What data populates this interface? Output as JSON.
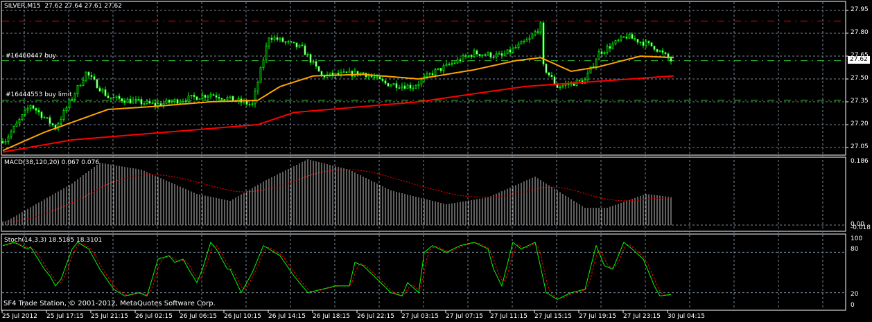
{
  "header": {
    "symbol": "SILVER,M15",
    "ohlc": "27.62 27.64 27.61 27.62"
  },
  "orders": [
    {
      "label": "#16460447 buy",
      "price": 27.62,
      "color": "#32cd32"
    },
    {
      "label": "#16444553 buy limit",
      "price": 27.36,
      "color": "#32cd32"
    }
  ],
  "resistance_line": {
    "price": 27.88,
    "color": "#ff0000"
  },
  "current_price": "27.62",
  "price_scale": [
    "27.95",
    "27.80",
    "27.65",
    "27.50",
    "27.35",
    "27.20",
    "27.05"
  ],
  "macd": {
    "label": "MACD(38,120,20) 0.067 0.076",
    "scale": [
      "0.186",
      "0.00",
      "-0.018"
    ]
  },
  "stoch": {
    "label": "Stoch(14,3,3) 18.5185 18.3101",
    "scale": [
      "100",
      "80",
      "20",
      "0"
    ]
  },
  "copyright": "SF4 Trade Station, © 2001-2012, MetaQuotes Software Corp.",
  "time_labels": [
    "25 Jul 2012",
    "25 Jul 17:15",
    "25 Jul 21:15",
    "26 Jul 02:15",
    "26 Jul 06:15",
    "26 Jul 10:15",
    "26 Jul 14:15",
    "26 Jul 18:15",
    "26 Jul 22:15",
    "27 Jul 03:15",
    "27 Jul 07:15",
    "27 Jul 11:15",
    "27 Jul 15:15",
    "27 Jul 19:15",
    "27 Jul 23:15",
    "30 Jul 04:15"
  ],
  "chart_data": {
    "type": "candlestick",
    "bars": 242,
    "price_range": [
      26.98,
      27.98
    ],
    "close_anchors": [
      [
        1,
        27.1
      ],
      [
        10,
        27.33
      ],
      [
        19,
        27.18
      ],
      [
        30,
        27.54
      ],
      [
        38,
        27.38
      ],
      [
        55,
        27.33
      ],
      [
        75,
        27.4
      ],
      [
        90,
        27.33
      ],
      [
        96,
        27.78
      ],
      [
        108,
        27.7
      ],
      [
        115,
        27.52
      ],
      [
        130,
        27.54
      ],
      [
        138,
        27.47
      ],
      [
        148,
        27.45
      ],
      [
        155,
        27.54
      ],
      [
        170,
        27.67
      ],
      [
        180,
        27.65
      ],
      [
        190,
        27.76
      ],
      [
        194,
        27.85
      ],
      [
        195,
        27.58
      ],
      [
        200,
        27.45
      ],
      [
        210,
        27.49
      ],
      [
        215,
        27.67
      ],
      [
        225,
        27.78
      ],
      [
        235,
        27.71
      ],
      [
        241,
        27.62
      ]
    ],
    "ma_fast": {
      "color": "#ffa500",
      "anchors": [
        [
          0,
          27.03
        ],
        [
          15,
          27.15
        ],
        [
          38,
          27.3
        ],
        [
          55,
          27.32
        ],
        [
          75,
          27.35
        ],
        [
          92,
          27.36
        ],
        [
          100,
          27.45
        ],
        [
          112,
          27.52
        ],
        [
          130,
          27.53
        ],
        [
          150,
          27.5
        ],
        [
          170,
          27.56
        ],
        [
          185,
          27.62
        ],
        [
          194,
          27.64
        ],
        [
          205,
          27.55
        ],
        [
          215,
          27.58
        ],
        [
          230,
          27.65
        ],
        [
          242,
          27.64
        ]
      ]
    },
    "ma_slow": {
      "color": "#ff0000",
      "anchors": [
        [
          0,
          27.02
        ],
        [
          25,
          27.1
        ],
        [
          92,
          27.2
        ],
        [
          105,
          27.28
        ],
        [
          150,
          27.35
        ],
        [
          188,
          27.45
        ],
        [
          242,
          27.52
        ]
      ]
    },
    "macd_anchors": [
      [
        1,
        0.01
      ],
      [
        25,
        0.12
      ],
      [
        35,
        0.18
      ],
      [
        50,
        0.16
      ],
      [
        70,
        0.09
      ],
      [
        82,
        0.07
      ],
      [
        95,
        0.13
      ],
      [
        110,
        0.19
      ],
      [
        125,
        0.16
      ],
      [
        140,
        0.1
      ],
      [
        160,
        0.06
      ],
      [
        175,
        0.08
      ],
      [
        192,
        0.14
      ],
      [
        210,
        0.05
      ],
      [
        218,
        0.05
      ],
      [
        232,
        0.09
      ],
      [
        242,
        0.08
      ]
    ],
    "stoch_anchors": [
      [
        0,
        90
      ],
      [
        4,
        95
      ],
      [
        9,
        85
      ],
      [
        10,
        88
      ],
      [
        12,
        75
      ],
      [
        15,
        55
      ],
      [
        17,
        45
      ],
      [
        19,
        30
      ],
      [
        21,
        40
      ],
      [
        25,
        85
      ],
      [
        27,
        95
      ],
      [
        31,
        85
      ],
      [
        35,
        55
      ],
      [
        40,
        25
      ],
      [
        44,
        15
      ],
      [
        49,
        20
      ],
      [
        52,
        15
      ],
      [
        56,
        70
      ],
      [
        60,
        75
      ],
      [
        62,
        65
      ],
      [
        65,
        70
      ],
      [
        67,
        55
      ],
      [
        70,
        35
      ],
      [
        72,
        55
      ],
      [
        75,
        95
      ],
      [
        77,
        85
      ],
      [
        81,
        55
      ],
      [
        82,
        55
      ],
      [
        86,
        20
      ],
      [
        90,
        50
      ],
      [
        94,
        90
      ],
      [
        96,
        85
      ],
      [
        100,
        75
      ],
      [
        105,
        45
      ],
      [
        110,
        20
      ],
      [
        115,
        25
      ],
      [
        120,
        30
      ],
      [
        125,
        30
      ],
      [
        127,
        65
      ],
      [
        130,
        60
      ],
      [
        135,
        40
      ],
      [
        140,
        20
      ],
      [
        144,
        15
      ],
      [
        146,
        35
      ],
      [
        150,
        20
      ],
      [
        152,
        80
      ],
      [
        155,
        90
      ],
      [
        160,
        80
      ],
      [
        165,
        90
      ],
      [
        170,
        95
      ],
      [
        175,
        85
      ],
      [
        177,
        55
      ],
      [
        180,
        30
      ],
      [
        184,
        95
      ],
      [
        187,
        85
      ],
      [
        192,
        95
      ],
      [
        196,
        20
      ],
      [
        200,
        10
      ],
      [
        205,
        20
      ],
      [
        210,
        25
      ],
      [
        214,
        90
      ],
      [
        217,
        60
      ],
      [
        220,
        55
      ],
      [
        224,
        95
      ],
      [
        227,
        85
      ],
      [
        231,
        70
      ],
      [
        235,
        30
      ],
      [
        237,
        15
      ],
      [
        242,
        18
      ]
    ]
  }
}
